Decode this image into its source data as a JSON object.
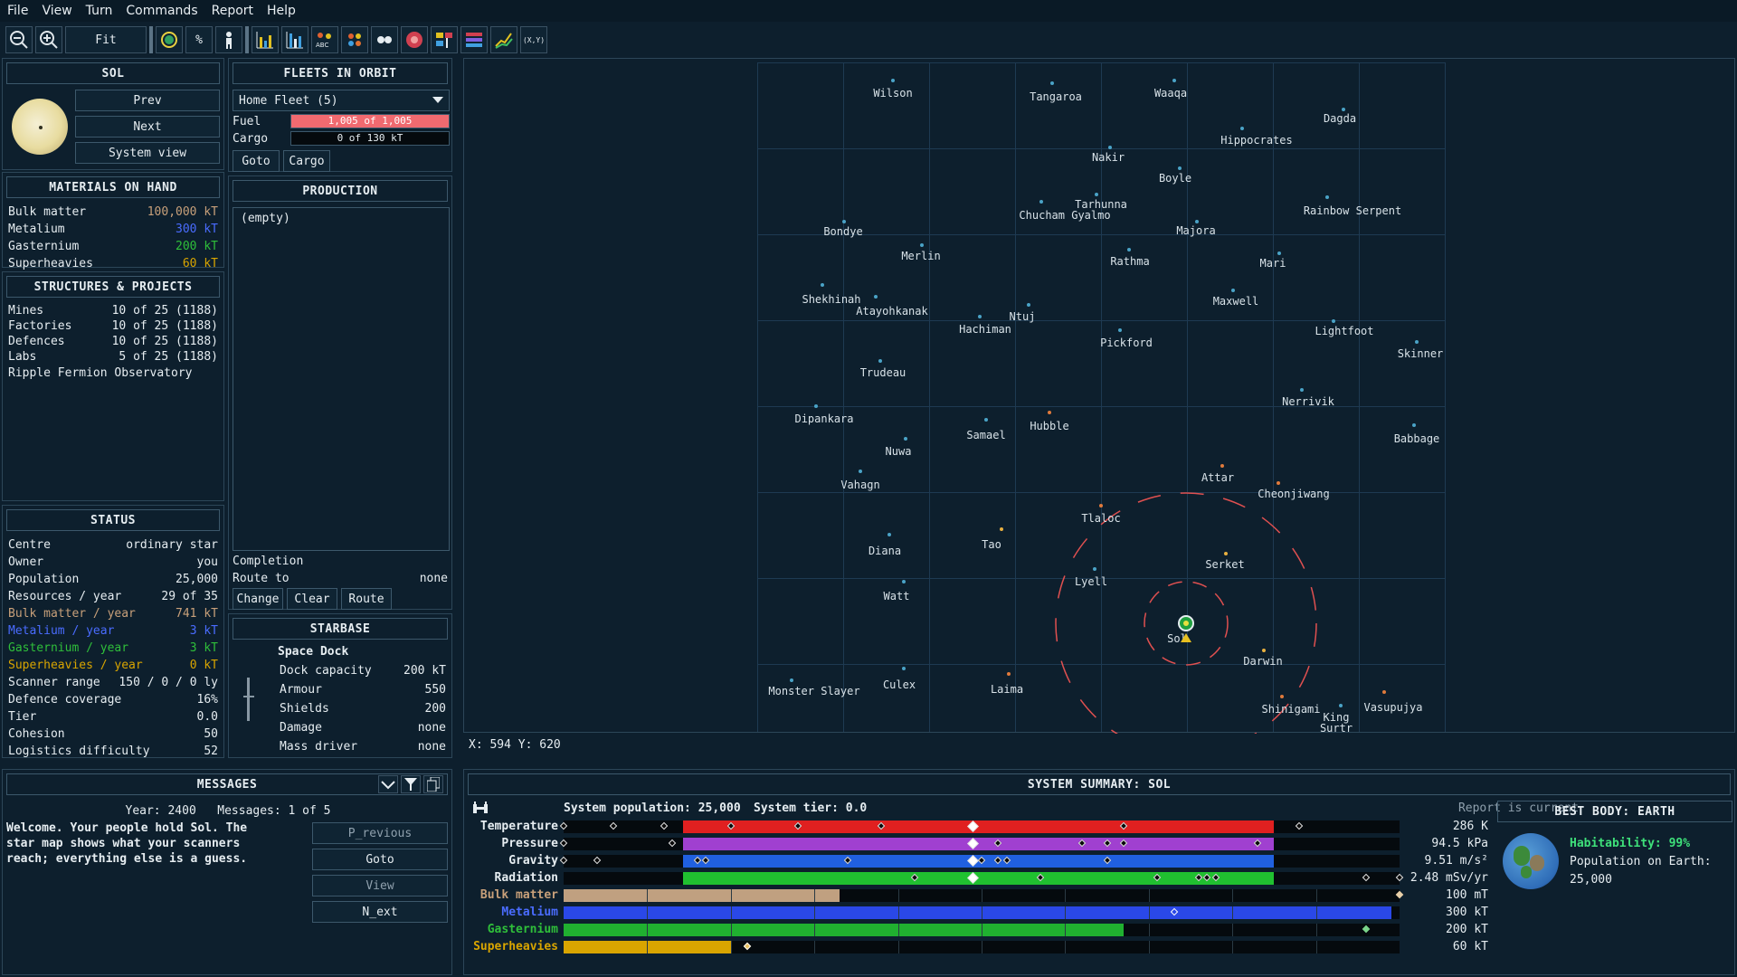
{
  "menu": [
    "File",
    "View",
    "Turn",
    "Commands",
    "Report",
    "Help"
  ],
  "toolbar": {
    "fit_label": "Fit",
    "percent_label": "%",
    "coord_label": "(X,Y)",
    "abc_label": "ABC"
  },
  "system": {
    "name": "SOL",
    "prev": "Prev",
    "next": "Next",
    "system_view": "System view"
  },
  "materials": {
    "title": "MATERIALS ON HAND",
    "items": [
      {
        "label": "Bulk matter",
        "value": "100,000 kT",
        "color": "#c8a07a"
      },
      {
        "label": "Metalium",
        "value": "300 kT",
        "color": "#4a6cff"
      },
      {
        "label": "Gasternium",
        "value": "200 kT",
        "color": "#2fbf3a"
      },
      {
        "label": "Superheavies",
        "value": "60 kT",
        "color": "#d9a500"
      }
    ]
  },
  "structures": {
    "title": "STRUCTURES & PROJECTS",
    "items": [
      {
        "label": "Mines",
        "value": "10 of 25 (1188)"
      },
      {
        "label": "Factories",
        "value": "10 of 25 (1188)"
      },
      {
        "label": "Defences",
        "value": "10 of 25 (1188)"
      },
      {
        "label": "Labs",
        "value": "5 of 25 (1188)"
      }
    ],
    "project": "Ripple Fermion Observatory"
  },
  "status": {
    "title": "STATUS",
    "items": [
      {
        "label": "Centre",
        "value": "ordinary star",
        "color": "#e6edf1"
      },
      {
        "label": "Owner",
        "value": "you",
        "color": "#e6edf1"
      },
      {
        "label": "Population",
        "value": "25,000",
        "color": "#e6edf1"
      },
      {
        "label": "Resources / year",
        "value": "29 of 35",
        "color": "#e6edf1"
      },
      {
        "label": "Bulk matter / year",
        "value": "741 kT",
        "color": "#c8a07a"
      },
      {
        "label": "Metalium / year",
        "value": "3 kT",
        "color": "#4a6cff"
      },
      {
        "label": "Gasternium / year",
        "value": "3 kT",
        "color": "#2fbf3a"
      },
      {
        "label": "Superheavies / year",
        "value": "0 kT",
        "color": "#d9a500"
      },
      {
        "label": "Scanner range",
        "value": "150 / 0 / 0 ly",
        "color": "#e6edf1"
      },
      {
        "label": "Defence coverage",
        "value": "16%",
        "color": "#e6edf1"
      },
      {
        "label": "Tier",
        "value": "0.0",
        "color": "#e6edf1"
      },
      {
        "label": "Cohesion",
        "value": "50",
        "color": "#e6edf1"
      },
      {
        "label": "Logistics difficulty",
        "value": "52",
        "color": "#e6edf1"
      }
    ]
  },
  "fleets": {
    "title": "FLEETS IN ORBIT",
    "selected": "Home Fleet (5)",
    "fuel_label": "Fuel",
    "fuel_value": "1,005 of 1,005",
    "fuel_fraction": 1.0,
    "cargo_label": "Cargo",
    "cargo_value": "0 of 130 kT",
    "goto": "Goto",
    "cargo_btn": "Cargo"
  },
  "production": {
    "title": "PRODUCTION",
    "queue_text": "(empty)",
    "completion_label": "Completion",
    "completion_value": "",
    "route_label": "Route to",
    "route_value": "none",
    "change": "Change",
    "clear": "Clear",
    "route_btn": "Route"
  },
  "starbase": {
    "title": "STARBASE",
    "name": "Space Dock",
    "items": [
      {
        "label": "Dock capacity",
        "value": "200 kT"
      },
      {
        "label": "Armour",
        "value": "550"
      },
      {
        "label": "Shields",
        "value": "200"
      },
      {
        "label": "Damage",
        "value": "none"
      },
      {
        "label": "Mass driver",
        "value": "none"
      }
    ]
  },
  "map": {
    "coords": "X: 594   Y: 620",
    "stars": [
      {
        "name": "Wilson",
        "color": "blue"
      },
      {
        "name": "Tangaroa",
        "color": "blue"
      },
      {
        "name": "Waaqa",
        "color": "blue"
      },
      {
        "name": "Dagda",
        "color": "blue"
      },
      {
        "name": "Hippocrates",
        "color": "blue"
      },
      {
        "name": "Nakir",
        "color": "blue"
      },
      {
        "name": "Boyle",
        "color": "blue"
      },
      {
        "name": "Tarhunna",
        "color": "blue"
      },
      {
        "name": "Chucham Gyalmo",
        "color": "blue"
      },
      {
        "name": "Rainbow Serpent",
        "color": "blue"
      },
      {
        "name": "Bondye",
        "color": "blue"
      },
      {
        "name": "Majora",
        "color": "blue"
      },
      {
        "name": "Merlin",
        "color": "blue"
      },
      {
        "name": "Rathma",
        "color": "blue"
      },
      {
        "name": "Mari",
        "color": "blue"
      },
      {
        "name": "Shekhinah",
        "color": "blue"
      },
      {
        "name": "Atayohkanak",
        "color": "blue"
      },
      {
        "name": "Maxwell",
        "color": "blue"
      },
      {
        "name": "Ntuj",
        "color": "blue"
      },
      {
        "name": "Hachiman",
        "color": "blue"
      },
      {
        "name": "Lightfoot",
        "color": "blue"
      },
      {
        "name": "Pickford",
        "color": "blue"
      },
      {
        "name": "Skinner",
        "color": "blue"
      },
      {
        "name": "Trudeau",
        "color": "blue"
      },
      {
        "name": "Nerrivik",
        "color": "blue"
      },
      {
        "name": "Dipankara",
        "color": "blue"
      },
      {
        "name": "Hubble",
        "color": "orange"
      },
      {
        "name": "Samael",
        "color": "blue"
      },
      {
        "name": "Babbage",
        "color": "blue"
      },
      {
        "name": "Nuwa",
        "color": "blue"
      },
      {
        "name": "Attar",
        "color": "orange"
      },
      {
        "name": "Vahagn",
        "color": "blue"
      },
      {
        "name": "Cheonjiwang",
        "color": "orange"
      },
      {
        "name": "Tlaloc",
        "color": "orange"
      },
      {
        "name": "Tao",
        "color": "yellow"
      },
      {
        "name": "Diana",
        "color": "blue"
      },
      {
        "name": "Serket",
        "color": "yellow"
      },
      {
        "name": "Lyell",
        "color": "blue"
      },
      {
        "name": "Watt",
        "color": "blue"
      },
      {
        "name": "Sol",
        "color": "yellow"
      },
      {
        "name": "Darwin",
        "color": "yellow"
      },
      {
        "name": "Monster Slayer",
        "color": "blue"
      },
      {
        "name": "Culex",
        "color": "blue"
      },
      {
        "name": "Laima",
        "color": "orange"
      },
      {
        "name": "Shinigami",
        "color": "orange"
      },
      {
        "name": "King Surtr",
        "color": "blue"
      },
      {
        "name": "Vasupujya",
        "color": "orange"
      }
    ]
  },
  "messages": {
    "title": "MESSAGES",
    "year_label": "Year: 2400",
    "count_label": "Messages: 1 of 5",
    "text": "Welcome. Your people hold Sol. The star map shows what your scanners reach; everything else is a guess.",
    "previous": "P_revious",
    "goto": "Goto",
    "view": "View",
    "next": "N_ext"
  },
  "summary": {
    "title": "SYSTEM SUMMARY: SOL",
    "population": "System population: 25,000",
    "tier": "System tier: 0.0",
    "report_status": "Report is current",
    "rows": [
      {
        "label": "Temperature",
        "value": "286 K",
        "color": "#e02020",
        "label_color": "#e6edf1",
        "start": 0.143,
        "end": 0.85
      },
      {
        "label": "Pressure",
        "value": "94.5 kPa",
        "color": "#a040d0",
        "label_color": "#e6edf1",
        "start": 0.143,
        "end": 0.85
      },
      {
        "label": "Gravity",
        "value": "9.51 m/s²",
        "color": "#2060e0",
        "label_color": "#e6edf1",
        "start": 0.143,
        "end": 0.85
      },
      {
        "label": "Radiation",
        "value": "2.48 mSv/yr",
        "color": "#20c030",
        "label_color": "#e6edf1",
        "start": 0.143,
        "end": 0.85
      },
      {
        "label": "Bulk matter",
        "value": "100 mT",
        "color": "#c0a080",
        "label_color": "#c8a07a",
        "start": 0.0,
        "end": 0.33
      },
      {
        "label": "Metalium",
        "value": "300 kT",
        "color": "#2a48e8",
        "label_color": "#4a6cff",
        "start": 0.0,
        "end": 0.99
      },
      {
        "label": "Gasternium",
        "value": "200 kT",
        "color": "#20b030",
        "label_color": "#2fbf3a",
        "start": 0.0,
        "end": 0.67
      },
      {
        "label": "Superheavies",
        "value": "60 kT",
        "color": "#d9a500",
        "label_color": "#d9a500",
        "start": 0.0,
        "end": 0.2
      }
    ]
  },
  "best_body": {
    "title": "BEST BODY: EARTH",
    "habitability": "Habitability: 99%",
    "population_label": "Population on Earth:",
    "population_value": "25,000"
  }
}
